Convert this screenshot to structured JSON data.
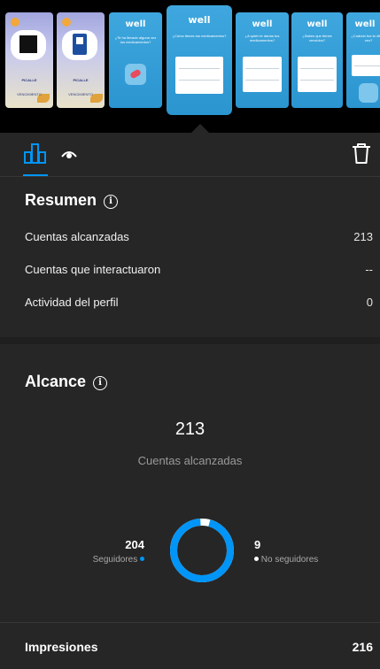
{
  "story_strip": {
    "thumbnails": [
      {
        "style": "white",
        "caption": "PICALLE",
        "footer": "VENCIMIENTO"
      },
      {
        "style": "white",
        "caption": "PICALLE",
        "footer": "VENCIMIENTO"
      },
      {
        "style": "blue",
        "brand": "well",
        "question": "¿Te ha llevado alguna vez tus medicamentos?"
      },
      {
        "style": "blue",
        "brand": "well",
        "question": "¿Cómo tienes tus medicamentos?",
        "selected": true
      },
      {
        "style": "blue",
        "brand": "well",
        "question": "¿A quién le darías tus medicamentos?"
      },
      {
        "style": "blue",
        "brand": "well",
        "question": "¿Sabes que tienes vencidos?"
      },
      {
        "style": "blue",
        "brand": "well",
        "question": "¿Cuándo fue la última vez?"
      }
    ]
  },
  "tabs": [
    {
      "name": "insights",
      "icon": "bar-chart-icon",
      "active": true
    },
    {
      "name": "viewers",
      "icon": "eye-icon",
      "active": false
    }
  ],
  "actions": {
    "delete_icon": "trash-icon"
  },
  "resumen": {
    "title": "Resumen",
    "rows": [
      {
        "label": "Cuentas alcanzadas",
        "value": "213"
      },
      {
        "label": "Cuentas que interactuaron",
        "value": "--"
      },
      {
        "label": "Actividad del perfil",
        "value": "0"
      }
    ]
  },
  "alcance": {
    "title": "Alcance",
    "total": "213",
    "total_label": "Cuentas alcanzadas",
    "followers": {
      "value": "204",
      "label": "Seguidores"
    },
    "non_followers": {
      "value": "9",
      "label": "No seguidores"
    },
    "followers_fraction": 0.958
  },
  "impresiones": {
    "label": "Impresiones",
    "value": "216"
  },
  "colors": {
    "accent": "#0095f6",
    "background": "#262626",
    "non_follower": "#ffffff"
  }
}
